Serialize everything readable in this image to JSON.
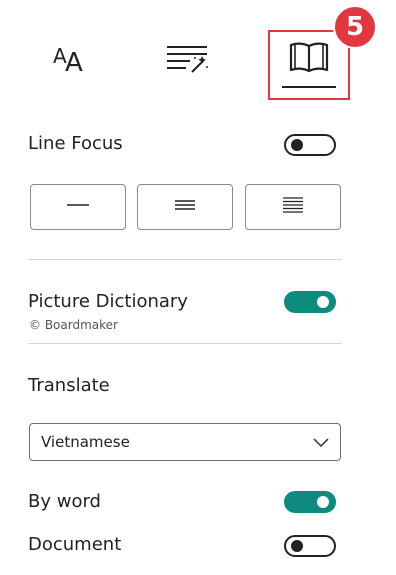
{
  "tabs": {
    "text_preferences_icon": "text-size-icon",
    "grammar_options_icon": "grammar-options-icon",
    "reading_preferences_icon": "book-icon"
  },
  "step_badge": "5",
  "line_focus": {
    "label": "Line Focus",
    "enabled": false,
    "options": [
      {
        "lines": 1
      },
      {
        "lines": 3
      },
      {
        "lines": 5
      }
    ]
  },
  "picture_dictionary": {
    "label": "Picture Dictionary",
    "credit": "© Boardmaker",
    "enabled": true
  },
  "translate": {
    "label": "Translate",
    "language": "Vietnamese",
    "by_word_label": "By word",
    "by_word_enabled": true,
    "document_label": "Document",
    "document_enabled": false
  },
  "colors": {
    "accent_toggle": "#0f8a7e",
    "highlight": "#e2373f"
  }
}
